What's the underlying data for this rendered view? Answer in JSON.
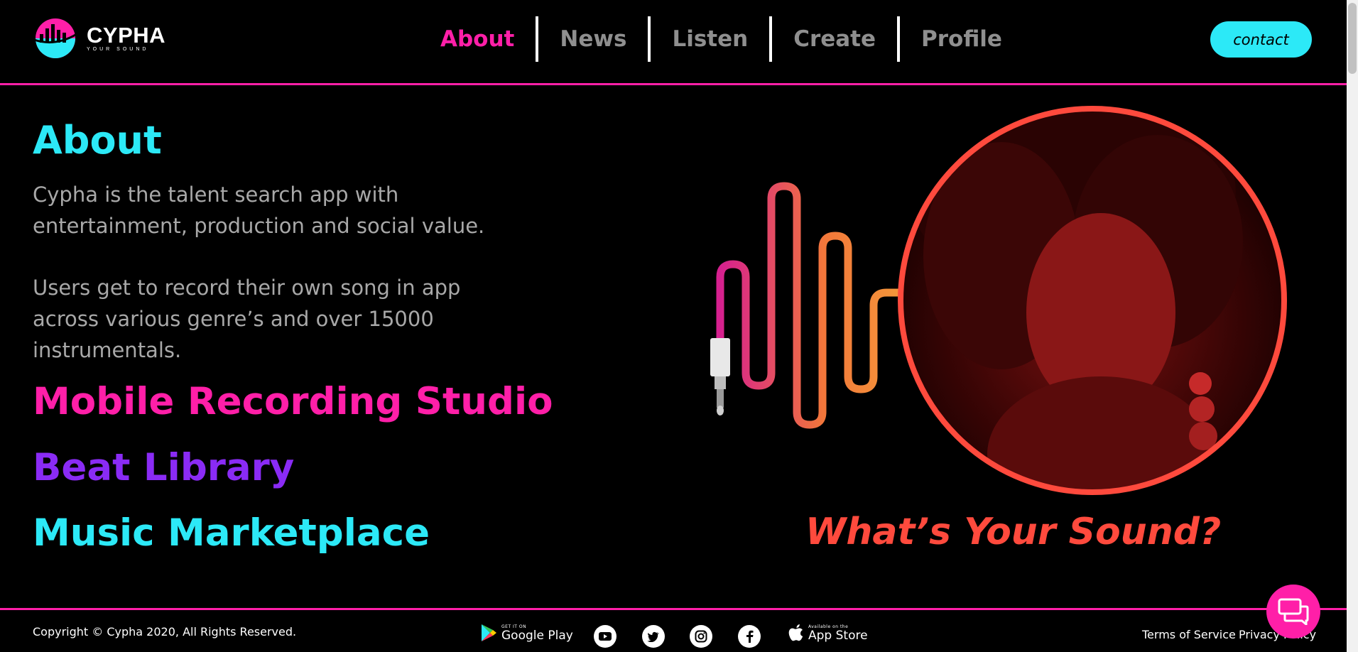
{
  "brand": {
    "name": "CYPHA",
    "tagline": "YOUR SOUND"
  },
  "nav": {
    "items": [
      {
        "label": "About",
        "active": true
      },
      {
        "label": "News",
        "active": false
      },
      {
        "label": "Listen",
        "active": false
      },
      {
        "label": "Create",
        "active": false
      },
      {
        "label": "Profile",
        "active": false
      }
    ],
    "contact_label": "contact"
  },
  "about": {
    "title": "About",
    "paragraph1": "Cypha is the talent search app with entertainment, production and social value.",
    "paragraph2": "Users get to record their own song in app across various genre’s and over 15000 instrumentals."
  },
  "features": [
    {
      "label": "Mobile Recording Studio",
      "color": "#ff1fa8"
    },
    {
      "label": "Beat Library",
      "color": "#8a2bf5"
    },
    {
      "label": "Music Marketplace",
      "color": "#2ce9f7"
    }
  ],
  "hero": {
    "tagline": "What’s Your Sound?"
  },
  "footer": {
    "copyright": "Copyright © Cypha 2020, All Rights Reserved.",
    "google_play": {
      "small": "GET IT ON",
      "big": "Google Play"
    },
    "app_store": {
      "small": "Available on the",
      "big": "App Store"
    },
    "social": [
      "youtube-icon",
      "twitter-icon",
      "instagram-icon",
      "facebook-icon"
    ],
    "terms": "Terms of Service",
    "privacy": "Privacy Policy"
  },
  "colors": {
    "accent_pink": "#ff1fa8",
    "accent_cyan": "#2ce9f7",
    "accent_purple": "#8a2bf5",
    "accent_red": "#ff4a3d"
  }
}
